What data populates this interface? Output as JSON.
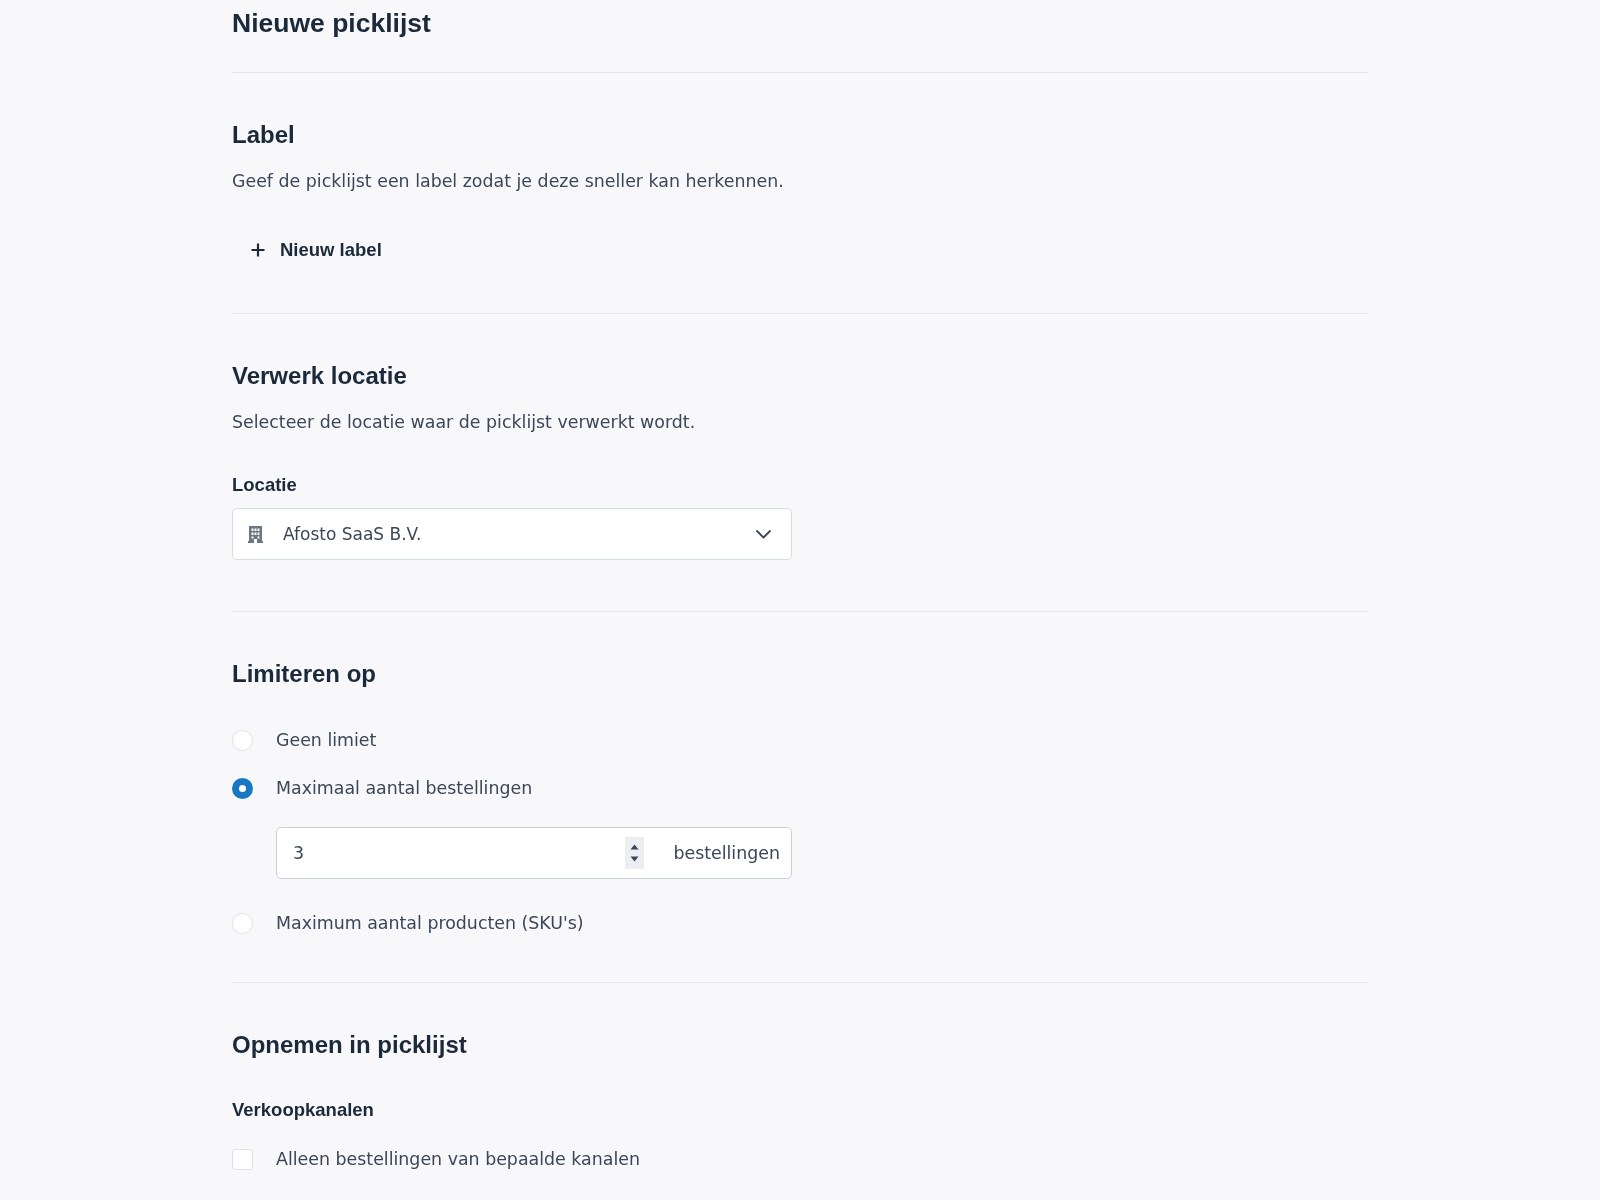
{
  "page": {
    "title": "Nieuwe picklijst"
  },
  "sections": [
    {
      "kind": "label",
      "heading": "Label",
      "description": "Geef de picklijst een label zodat je deze sneller kan herkennen.",
      "add_button": {
        "label": "Nieuw label"
      }
    },
    {
      "kind": "location",
      "heading": "Verwerk locatie",
      "description": "Selecteer de locatie waar de picklijst verwerkt wordt.",
      "field": {
        "label": "Locatie",
        "value": "Afosto SaaS B.V."
      }
    },
    {
      "kind": "limit",
      "heading": "Limiteren op",
      "options": [
        {
          "label": "Geen limiet",
          "selected": false
        },
        {
          "label": "Maximaal aantal bestellingen",
          "selected": true,
          "input": {
            "value": "3",
            "unit": "bestellingen"
          }
        },
        {
          "label": "Maximum aantal producten (SKU's)",
          "selected": false
        }
      ]
    },
    {
      "kind": "include",
      "heading": "Opnemen in picklijst",
      "groups": [
        {
          "label": "Verkoopkanalen",
          "checkboxes": [
            {
              "label": "Alleen bestellingen van bepaalde kanalen",
              "checked": false
            }
          ]
        }
      ]
    }
  ]
}
